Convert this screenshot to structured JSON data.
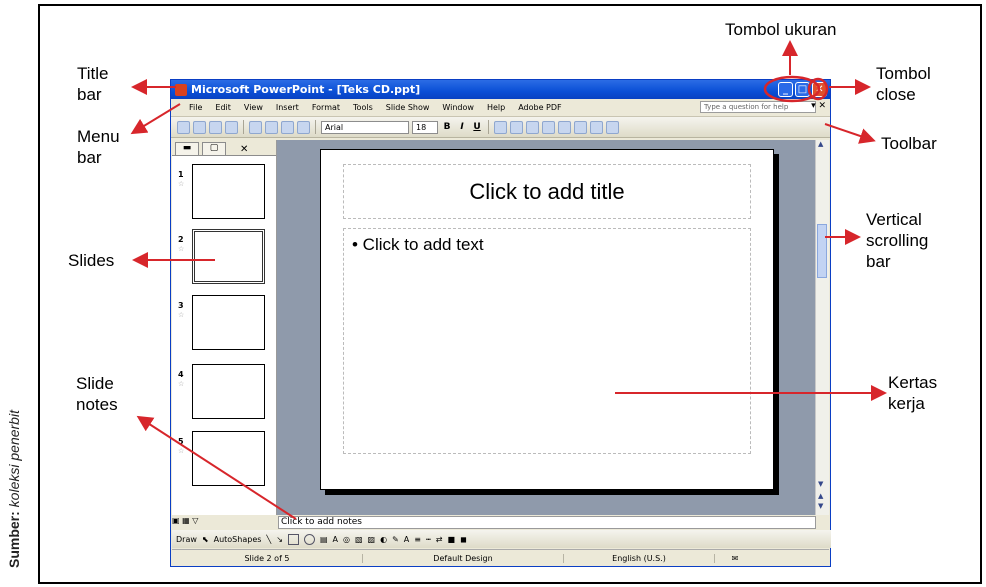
{
  "source": {
    "label": "Sumber:",
    "value": "koleksi penerbit"
  },
  "annotations": {
    "title_bar": "Title\nbar",
    "menu_bar": "Menu\nbar",
    "slides": "Slides",
    "slide_notes": "Slide\nnotes",
    "tombol_ukuran": "Tombol ukuran",
    "tombol_close": "Tombol\nclose",
    "toolbar": "Toolbar",
    "vertical_scrolling_bar": "Vertical\nscrolling\nbar",
    "kertas_kerja": "Kertas\nkerja"
  },
  "window": {
    "title": "Microsoft PowerPoint - [Teks CD.ppt]",
    "menu": [
      "File",
      "Edit",
      "View",
      "Insert",
      "Format",
      "Tools",
      "Slide Show",
      "Window",
      "Help",
      "Adobe PDF"
    ],
    "ask_placeholder": "Type a question for help",
    "font_name": "Arial",
    "font_size": "18",
    "bold": "B",
    "italic": "I",
    "underline": "U",
    "thumb_numbers": [
      "1",
      "2",
      "3",
      "4",
      "5"
    ],
    "slide_title": "Click to add title",
    "slide_body": "• Click to add text",
    "notes": "Click to add notes",
    "draw_label": "Draw",
    "autoshapes_label": "AutoShapes",
    "status": {
      "slide": "Slide 2 of 5",
      "design": "Default Design",
      "language": "English (U.S.)"
    }
  },
  "colors": {
    "title_bar": "#0a4fd6",
    "arrow": "#d7262b",
    "canvas": "#8f9aab"
  }
}
